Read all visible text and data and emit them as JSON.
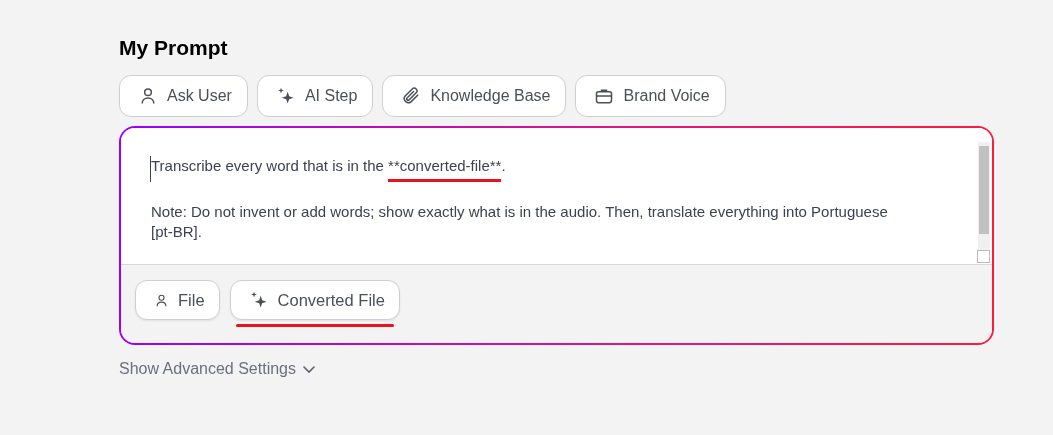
{
  "title": "My Prompt",
  "toolbar": [
    {
      "label": "Ask User",
      "kind": "person"
    },
    {
      "label": "AI Step",
      "kind": "sparkle"
    },
    {
      "label": "Knowledge Base",
      "kind": "paperclip"
    },
    {
      "label": "Brand Voice",
      "kind": "briefcase"
    }
  ],
  "prompt": {
    "paragraphs": [
      [
        {
          "text": "Transcribe every word that is in the ",
          "underlined": false
        },
        {
          "text": "**converted-file**",
          "underlined": true
        },
        {
          "text": ".",
          "underlined": false
        }
      ],
      [
        {
          "text": "Note: Do not invent or add words; show exactly what is in the audio. Then, translate everything into Portuguese [pt-BR].",
          "underlined": false
        }
      ]
    ],
    "variables": [
      {
        "label": "File",
        "kind": "person",
        "underlined": false
      },
      {
        "label": "Converted File",
        "kind": "sparkle",
        "underlined": true
      }
    ]
  },
  "advanced_toggle": {
    "label": "Show Advanced Settings",
    "expanded": false
  }
}
